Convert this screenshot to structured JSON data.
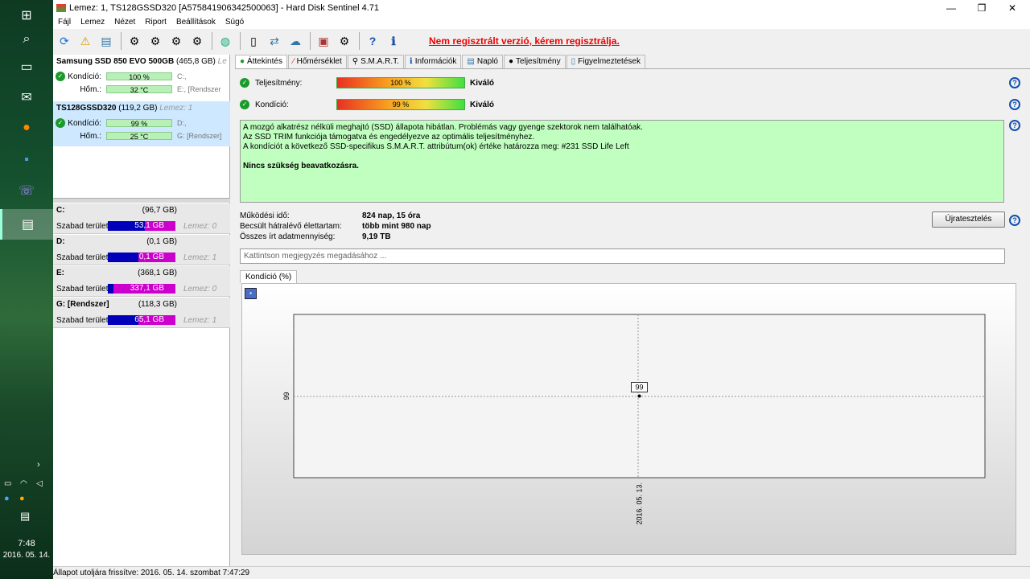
{
  "taskbar": {
    "time": "7:48",
    "date": "2016. 05. 14."
  },
  "window": {
    "title": "Lemez: 1, TS128GSSD320 [A575841906342500063]  -  Hard Disk Sentinel 4.71",
    "minimize": "—",
    "maximize": "❐",
    "close": "✕"
  },
  "menu": [
    "Fájl",
    "Lemez",
    "Nézet",
    "Riport",
    "Beállítások",
    "Súgó"
  ],
  "toolbar": {
    "unregistered": "Nem regisztrált verzió, kérem regisztrálja."
  },
  "disks": [
    {
      "name": "Samsung SSD 850 EVO 500GB",
      "size": "(465,8 GB)",
      "disk_tag": "Le",
      "condition_label": "Kondíció:",
      "condition": "100 %",
      "condition_drive": "C:,",
      "temp_label": "Hőm.:",
      "temp": "32 °C",
      "temp_drive": "E:, [Rendszer"
    },
    {
      "name": "TS128GSSD320",
      "size": "(119,2 GB)",
      "disk_tag": "Lemez: 1",
      "condition_label": "Kondíció:",
      "condition": "99 %",
      "condition_drive": "D:,",
      "temp_label": "Hőm.:",
      "temp": "25 °C",
      "temp_drive": "G: [Rendszer]"
    }
  ],
  "partitions": [
    {
      "name": "C:",
      "size": "(96,7 GB)",
      "free_label": "Szabad terület",
      "free": "53,1 GB",
      "disk": "Lemez: 0",
      "used_fraction": 0.55
    },
    {
      "name": "D:",
      "size": "(0,1 GB)",
      "free_label": "Szabad terület",
      "free": "0,1 GB",
      "disk": "Lemez: 1",
      "used_fraction": 0.45
    },
    {
      "name": "E:",
      "size": "(368,1 GB)",
      "free_label": "Szabad terület",
      "free": "337,1 GB",
      "disk": "Lemez: 0",
      "used_fraction": 0.08
    },
    {
      "name": "G: [Rendszer]",
      "size": "(118,3 GB)",
      "free_label": "Szabad terület",
      "free": "65,1 GB",
      "disk": "Lemez: 1",
      "used_fraction": 0.45
    }
  ],
  "tabs": [
    "Áttekintés",
    "Hőmérséklet",
    "S.M.A.R.T.",
    "Információk",
    "Napló",
    "Teljesítmény",
    "Figyelmeztetések"
  ],
  "metrics": {
    "performance_label": "Teljesítmény:",
    "performance": "100 %",
    "performance_rating": "Kiváló",
    "condition_label": "Kondíció:",
    "condition": "99 %",
    "condition_rating": "Kiváló"
  },
  "message": {
    "line1": "A mozgó alkatrész nélküli meghajtó (SSD) állapota hibátlan. Problémás vagy gyenge szektorok nem találhatóak.",
    "line2": "Az SSD TRIM funkciója támogatva és engedélyezve az optimális teljesítményhez.",
    "line3": "A kondíciót a következő SSD-specifikus S.M.A.R.T. attribútum(ok) értéke határozza meg:  #231 SSD Life Left",
    "line4": "Nincs szükség beavatkozásra."
  },
  "info": {
    "uptime_label": "Működési idő:",
    "uptime": "824 nap, 15 óra",
    "remaining_label": "Becsült hátralévő élettartam:",
    "remaining": "több mint 980 nap",
    "written_label": "Összes írt adatmennyiség:",
    "written": "9,19 TB",
    "retest_button": "Újratesztelés"
  },
  "note_placeholder": "Kattintson megjegyzés megadásához ...",
  "chart_tab": "Kondíció  (%)",
  "chart_data": {
    "type": "line",
    "title": "",
    "xlabel": "",
    "ylabel": "",
    "categories": [
      "2016. 05. 13."
    ],
    "series": [
      {
        "values": [
          99
        ]
      }
    ],
    "y_tick_labels": [
      "99"
    ],
    "data_labels": [
      "99"
    ],
    "ylim": [
      98,
      100
    ],
    "grid": true
  },
  "status": "Állapot utoljára frissítve: 2016. 05. 14. szombat 7:47:29"
}
